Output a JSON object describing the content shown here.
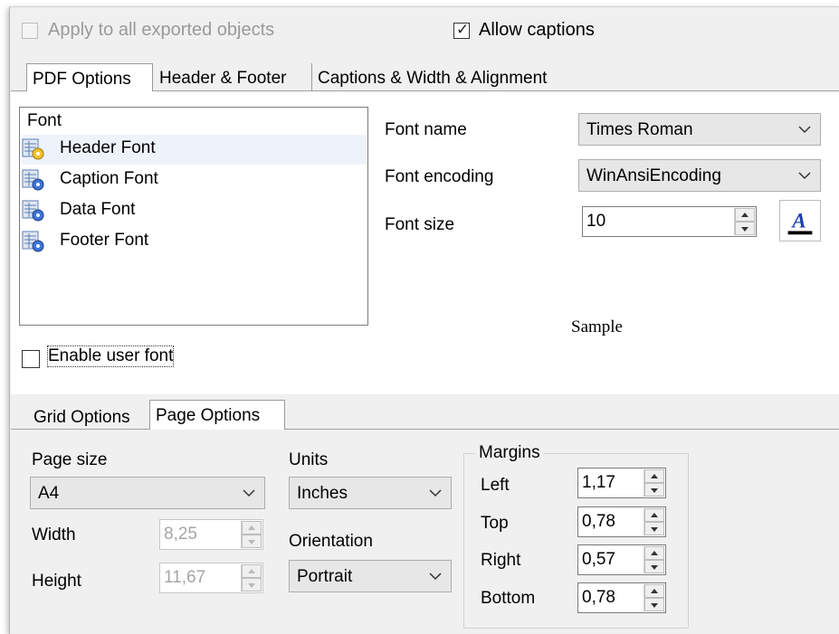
{
  "top": {
    "apply_all_label": "Apply to all exported objects",
    "apply_all_checked": false,
    "allow_captions_label": "Allow captions",
    "allow_captions_checked": true
  },
  "main_tabs": [
    {
      "label": "PDF Options",
      "active": true
    },
    {
      "label": "Header & Footer",
      "active": false
    },
    {
      "label": "Captions & Width & Alignment",
      "active": false
    }
  ],
  "font_list": {
    "header": "Font",
    "items": [
      {
        "label": "Header Font",
        "icon": "font-settings-icon-yellow",
        "selected": true
      },
      {
        "label": "Caption Font",
        "icon": "font-settings-icon-blue",
        "selected": false
      },
      {
        "label": "Data Font",
        "icon": "font-settings-icon-blue",
        "selected": false
      },
      {
        "label": "Footer Font",
        "icon": "font-settings-icon-blue",
        "selected": false
      }
    ]
  },
  "font_settings": {
    "name_label": "Font name",
    "name_value": "Times Roman",
    "encoding_label": "Font encoding",
    "encoding_value": "WinAnsiEncoding",
    "size_label": "Font size",
    "size_value": "10",
    "color_icon": "font-color-icon",
    "sample_text": "Sample"
  },
  "enable_user_font": {
    "label": "Enable user font",
    "checked": false
  },
  "bottom_tabs": [
    {
      "label": "Grid Options",
      "active": false
    },
    {
      "label": "Page Options",
      "active": true
    }
  ],
  "page_options": {
    "page_size_label": "Page size",
    "page_size_value": "A4",
    "width_label": "Width",
    "width_value": "8,25",
    "height_label": "Height",
    "height_value": "11,67",
    "units_label": "Units",
    "units_value": "Inches",
    "orientation_label": "Orientation",
    "orientation_value": "Portrait",
    "margins": {
      "title": "Margins",
      "left_label": "Left",
      "left_value": "1,17",
      "top_label": "Top",
      "top_value": "0,78",
      "right_label": "Right",
      "right_value": "0,57",
      "bottom_label": "Bottom",
      "bottom_value": "0,78"
    }
  },
  "colors": {
    "window_bg": "#f0f0f0",
    "selection_bg": "#eef3fb",
    "disabled_text": "#9a9a9a",
    "font_color_accent": "#1f3fb0"
  }
}
